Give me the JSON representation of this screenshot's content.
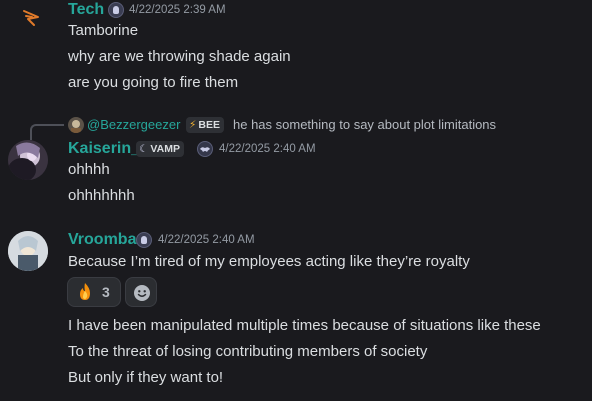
{
  "messages": [
    {
      "author": "Tech",
      "timestamp": "4/22/2025 2:39 AM",
      "lines": [
        "Tamborine",
        "why are we throwing shade again",
        "are you going to fire them"
      ]
    },
    {
      "reply": {
        "mention": "@Bezzergeezer",
        "tag": "BEE",
        "text": "he has something to say about plot limitations"
      },
      "author": "Kaiserin_",
      "tag": "VAMP",
      "timestamp": "4/22/2025 2:40 AM",
      "lines": [
        "ohhhh",
        "ohhhhhhh"
      ]
    },
    {
      "author": "Vroomba",
      "timestamp": "4/22/2025 2:40 AM",
      "lines": [
        "Because I’m tired of my employees acting like they’re royalty"
      ],
      "reactions": [
        {
          "emoji": "fire",
          "count": "3"
        }
      ],
      "more_lines": [
        "I have been manipulated multiple times because of situations like these",
        "To the threat of losing contributing members of society",
        "But only if they want to!"
      ]
    }
  ],
  "colors": {
    "username": "#26a69a",
    "background": "#1a1a1e",
    "text": "#dbdee1",
    "timestamp": "#949ba4"
  },
  "icons": [
    "avatar-tech-logo",
    "server-tag-badge",
    "fire-emoji",
    "add-reaction-icon",
    "bat-badge-icon"
  ]
}
